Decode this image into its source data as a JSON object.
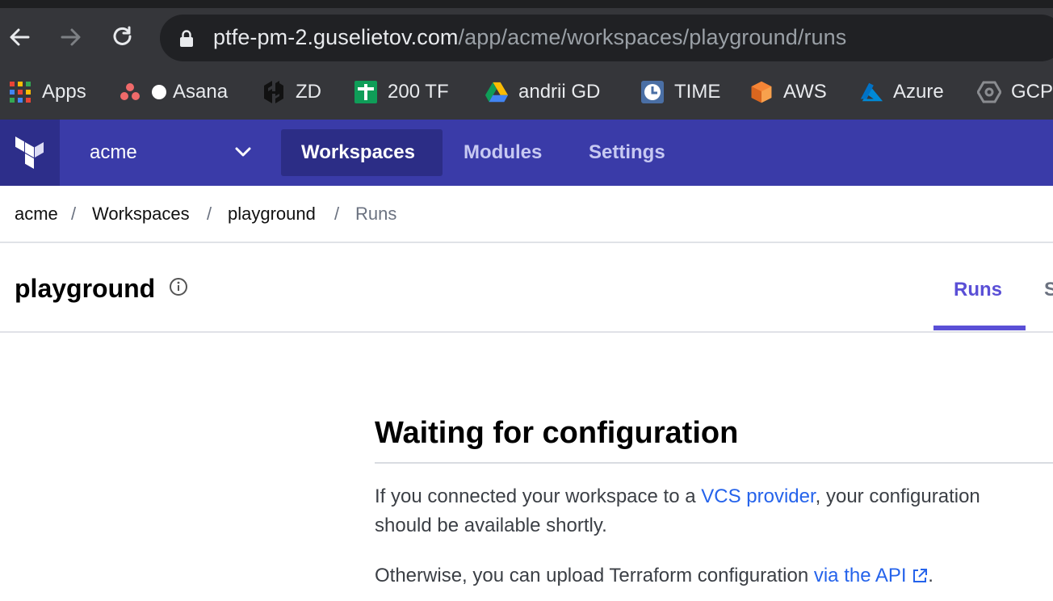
{
  "browser": {
    "url_host": "ptfe-pm-2.guselietov.com",
    "url_path": "/app/acme/workspaces/playground/runs",
    "bookmarks": [
      {
        "label": "Apps",
        "icon": "apps-grid-icon"
      },
      {
        "label": "Asana",
        "icon": "asana-icon"
      },
      {
        "label": "ZD",
        "icon": "hashicorp-icon"
      },
      {
        "label": "200 TF",
        "icon": "plus-sheet-icon"
      },
      {
        "label": "andrii  GD",
        "icon": "google-drive-icon"
      },
      {
        "label": "TIME",
        "icon": "clock-icon"
      },
      {
        "label": "AWS",
        "icon": "aws-cube-icon"
      },
      {
        "label": "Azure",
        "icon": "azure-icon"
      },
      {
        "label": "GCP",
        "icon": "gcp-hexagon-icon"
      }
    ]
  },
  "header": {
    "org": "acme",
    "nav": [
      "Workspaces",
      "Modules",
      "Settings"
    ],
    "active_nav": "Workspaces"
  },
  "breadcrumb": {
    "items": [
      "acme",
      "Workspaces",
      "playground",
      "Runs"
    ],
    "separator": "/"
  },
  "workspace": {
    "title": "playground",
    "tabs": [
      "Runs",
      "S"
    ],
    "active_tab": "Runs"
  },
  "main": {
    "heading": "Waiting for configuration",
    "p1_before": "If you connected your workspace to a ",
    "p1_link": "VCS provider",
    "p1_after": ", your configuration",
    "p1_line2": "should be available shortly.",
    "p2_before": "Otherwise, you can upload Terraform configuration ",
    "p2_link": "via the API",
    "p2_after": "."
  },
  "colors": {
    "header_bg": "#3a3ba8",
    "accent": "#5a4fd6",
    "link": "#2563eb"
  }
}
